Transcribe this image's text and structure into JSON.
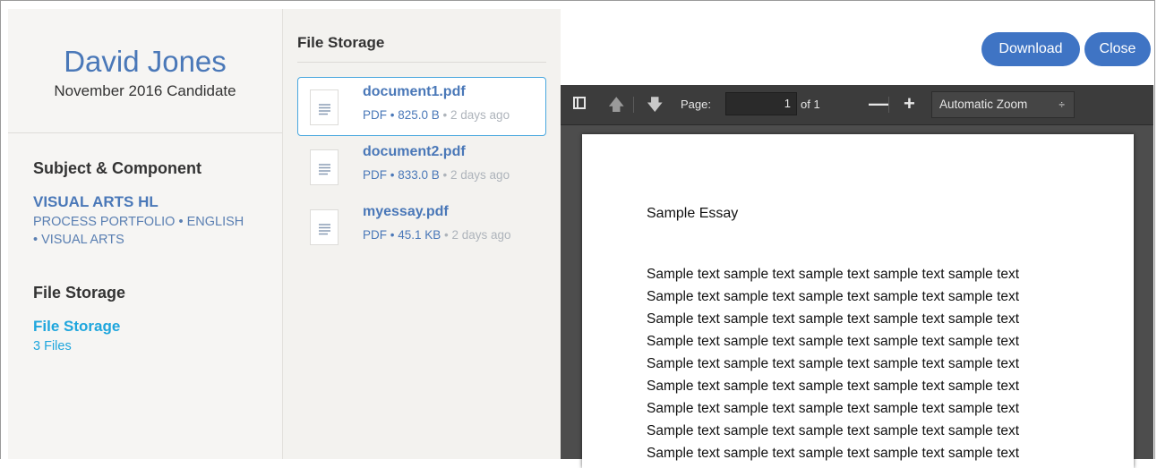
{
  "candidate": {
    "name": "David Jones",
    "session": "November 2016 Candidate"
  },
  "subject_section": {
    "heading": "Subject & Component",
    "subject": "VISUAL ARTS HL",
    "detail": "PROCESS PORTFOLIO • ENGLISH • VISUAL ARTS"
  },
  "storage_section": {
    "heading": "File Storage",
    "link": "File Storage",
    "count": "3 Files"
  },
  "file_list": {
    "heading": "File Storage",
    "files": [
      {
        "name": "document1.pdf",
        "meta": "PDF • 825.0 B",
        "ago": "• 2 days ago",
        "selected": true,
        "icon": "document-icon"
      },
      {
        "name": "document2.pdf",
        "meta": "PDF • 833.0 B",
        "ago": "• 2 days ago",
        "selected": false,
        "icon": "document-icon"
      },
      {
        "name": "myessay.pdf",
        "meta": "PDF • 45.1 KB",
        "ago": "• 2 days ago",
        "selected": false,
        "icon": "document-icon"
      }
    ]
  },
  "viewer": {
    "download_label": "Download",
    "close_label": "Close",
    "toolbar": {
      "page_label": "Page:",
      "page_value": "1",
      "page_of": "of 1",
      "zoom_value": "Automatic Zoom",
      "zoom_caret": "÷"
    },
    "document": {
      "title": "Sample Essay",
      "lines": [
        "Sample text sample text sample text sample text sample text",
        "Sample text sample text sample text sample text sample text",
        "Sample text sample text sample text sample text sample text",
        "Sample text sample text sample text sample text sample text",
        "Sample text sample text sample text sample text sample text",
        "Sample text sample text sample text sample text sample text",
        "Sample text sample text sample text sample text sample text",
        "Sample text sample text sample text sample text sample text",
        "Sample text sample text sample text sample text sample text"
      ]
    }
  },
  "colors": {
    "accent": "#4a78b8",
    "link": "#1fa6dd",
    "button": "#3f74c4",
    "selection_border": "#4aa8df"
  }
}
